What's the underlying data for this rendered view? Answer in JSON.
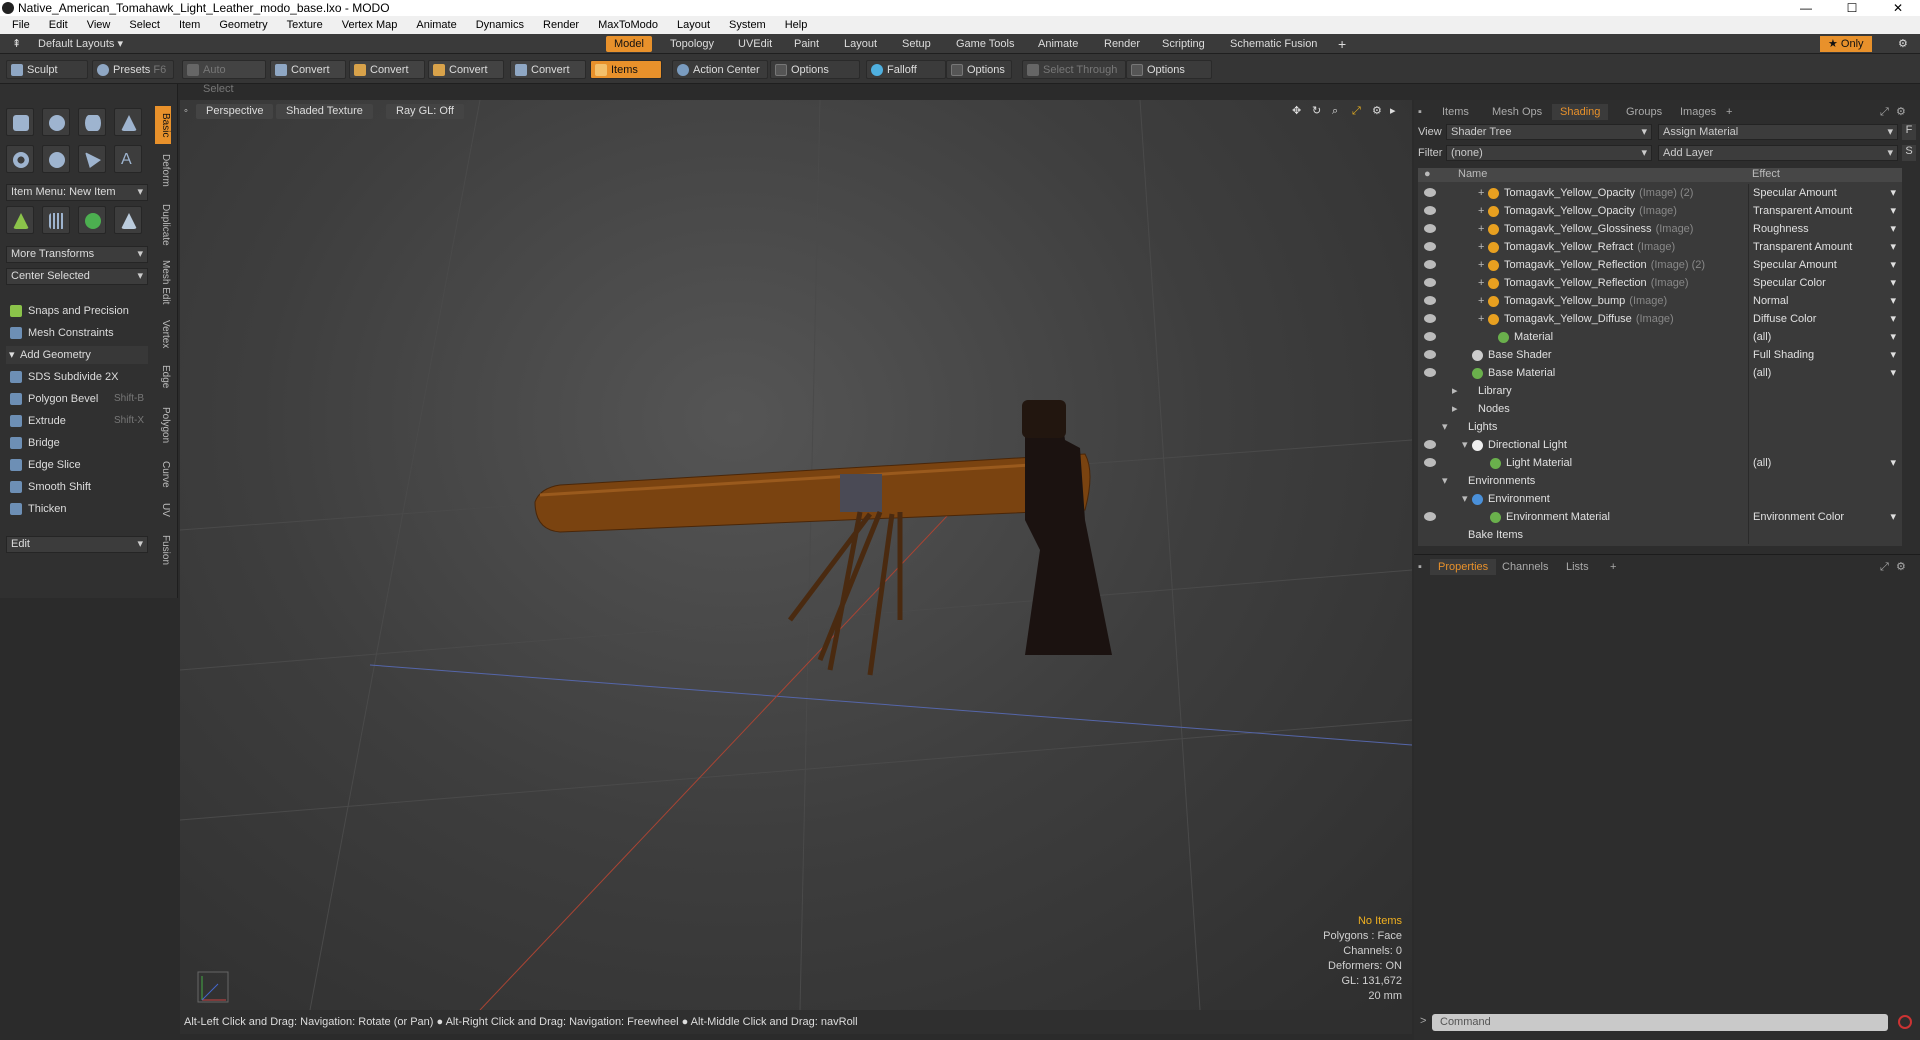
{
  "window": {
    "title": "Native_American_Tomahawk_Light_Leather_modo_base.lxo - MODO"
  },
  "menu": [
    "File",
    "Edit",
    "View",
    "Select",
    "Item",
    "Geometry",
    "Texture",
    "Vertex Map",
    "Animate",
    "Dynamics",
    "Render",
    "MaxToModo",
    "Layout",
    "System",
    "Help"
  ],
  "layoutbar": {
    "layouts_label": "Default Layouts",
    "tabs": [
      "Model",
      "Topology",
      "UVEdit",
      "Paint",
      "Layout",
      "Setup",
      "Game Tools",
      "Animate",
      "Render",
      "Scripting",
      "Schematic Fusion"
    ],
    "active_tab": "Model",
    "only_label": "Only"
  },
  "toolbar": {
    "sculpt": "Sculpt",
    "presets": "Presets",
    "presets_key": "F6",
    "auto_select": "Auto Select",
    "convert": "Convert",
    "items": "Items",
    "action_center": "Action Center",
    "options": "Options",
    "falloff": "Falloff",
    "select_through": "Select Through"
  },
  "left": {
    "item_menu": "Item Menu: New Item",
    "more_transforms": "More Transforms",
    "center_selected": "Center Selected",
    "snaps": "Snaps and Precision",
    "mesh_constraints": "Mesh Constraints",
    "add_geometry": "Add Geometry",
    "tools": [
      {
        "label": "SDS Subdivide 2X",
        "key": ""
      },
      {
        "label": "Polygon Bevel",
        "key": "Shift-B"
      },
      {
        "label": "Extrude",
        "key": "Shift-X"
      },
      {
        "label": "Bridge",
        "key": ""
      },
      {
        "label": "Edge Slice",
        "key": ""
      },
      {
        "label": "Smooth Shift",
        "key": ""
      },
      {
        "label": "Thicken",
        "key": ""
      }
    ],
    "edit_dd": "Edit",
    "vtabs": [
      "Basic",
      "Deform",
      "Duplicate",
      "Mesh Edit",
      "Vertex",
      "Edge",
      "Polygon",
      "Curve",
      "UV",
      "Fusion"
    ]
  },
  "viewport": {
    "perspective": "Perspective",
    "shaded": "Shaded Texture",
    "raygl": "Ray GL: Off",
    "info": {
      "no_items": "No Items",
      "polygons": "Polygons : Face",
      "channels": "Channels: 0",
      "deformers": "Deformers: ON",
      "gl": "GL: 131,672",
      "scale": "20 mm"
    }
  },
  "status": "Alt-Left Click and Drag: Navigation: Rotate (or Pan) ● Alt-Right Click and Drag: Navigation: Freewheel ● Alt-Middle Click and Drag: navRoll",
  "right": {
    "tabs": [
      "Items",
      "Mesh Ops",
      "Shading",
      "Groups",
      "Images"
    ],
    "active_tab": "Shading",
    "view_label": "View",
    "view_value": "Shader Tree",
    "assign_material": "Assign Material",
    "filter_label": "Filter",
    "filter_value": "(none)",
    "add_layer": "Add Layer",
    "col_name": "Name",
    "col_effect": "Effect",
    "rows": [
      {
        "name": "Tomagavk_Yellow_Opacity",
        "tag": "(Image) (2)",
        "effect": "Specular Amount"
      },
      {
        "name": "Tomagavk_Yellow_Opacity",
        "tag": "(Image)",
        "effect": "Transparent Amount"
      },
      {
        "name": "Tomagavk_Yellow_Glossiness",
        "tag": "(Image)",
        "effect": "Roughness"
      },
      {
        "name": "Tomagavk_Yellow_Refract",
        "tag": "(Image)",
        "effect": "Transparent Amount"
      },
      {
        "name": "Tomagavk_Yellow_Reflection",
        "tag": "(Image) (2)",
        "effect": "Specular Amount"
      },
      {
        "name": "Tomagavk_Yellow_Reflection",
        "tag": "(Image)",
        "effect": "Specular Color"
      },
      {
        "name": "Tomagavk_Yellow_bump",
        "tag": "(Image)",
        "effect": "Normal"
      },
      {
        "name": "Tomagavk_Yellow_Diffuse",
        "tag": "(Image)",
        "effect": "Diffuse Color"
      },
      {
        "name": "Material",
        "tag": "",
        "effect": "(all)"
      },
      {
        "name": "Base Shader",
        "tag": "",
        "effect": "Full Shading"
      },
      {
        "name": "Base Material",
        "tag": "",
        "effect": "(all)"
      },
      {
        "name": "Library",
        "tag": "",
        "effect": ""
      },
      {
        "name": "Nodes",
        "tag": "",
        "effect": ""
      },
      {
        "name": "Lights",
        "tag": "",
        "effect": ""
      },
      {
        "name": "Directional Light",
        "tag": "",
        "effect": ""
      },
      {
        "name": "Light Material",
        "tag": "",
        "effect": "(all)"
      },
      {
        "name": "Environments",
        "tag": "",
        "effect": ""
      },
      {
        "name": "Environment",
        "tag": "",
        "effect": ""
      },
      {
        "name": "Environment Material",
        "tag": "",
        "effect": "Environment Color"
      },
      {
        "name": "Bake Items",
        "tag": "",
        "effect": ""
      }
    ],
    "prop_tabs": [
      "Properties",
      "Channels",
      "Lists"
    ],
    "command_placeholder": "Command"
  }
}
